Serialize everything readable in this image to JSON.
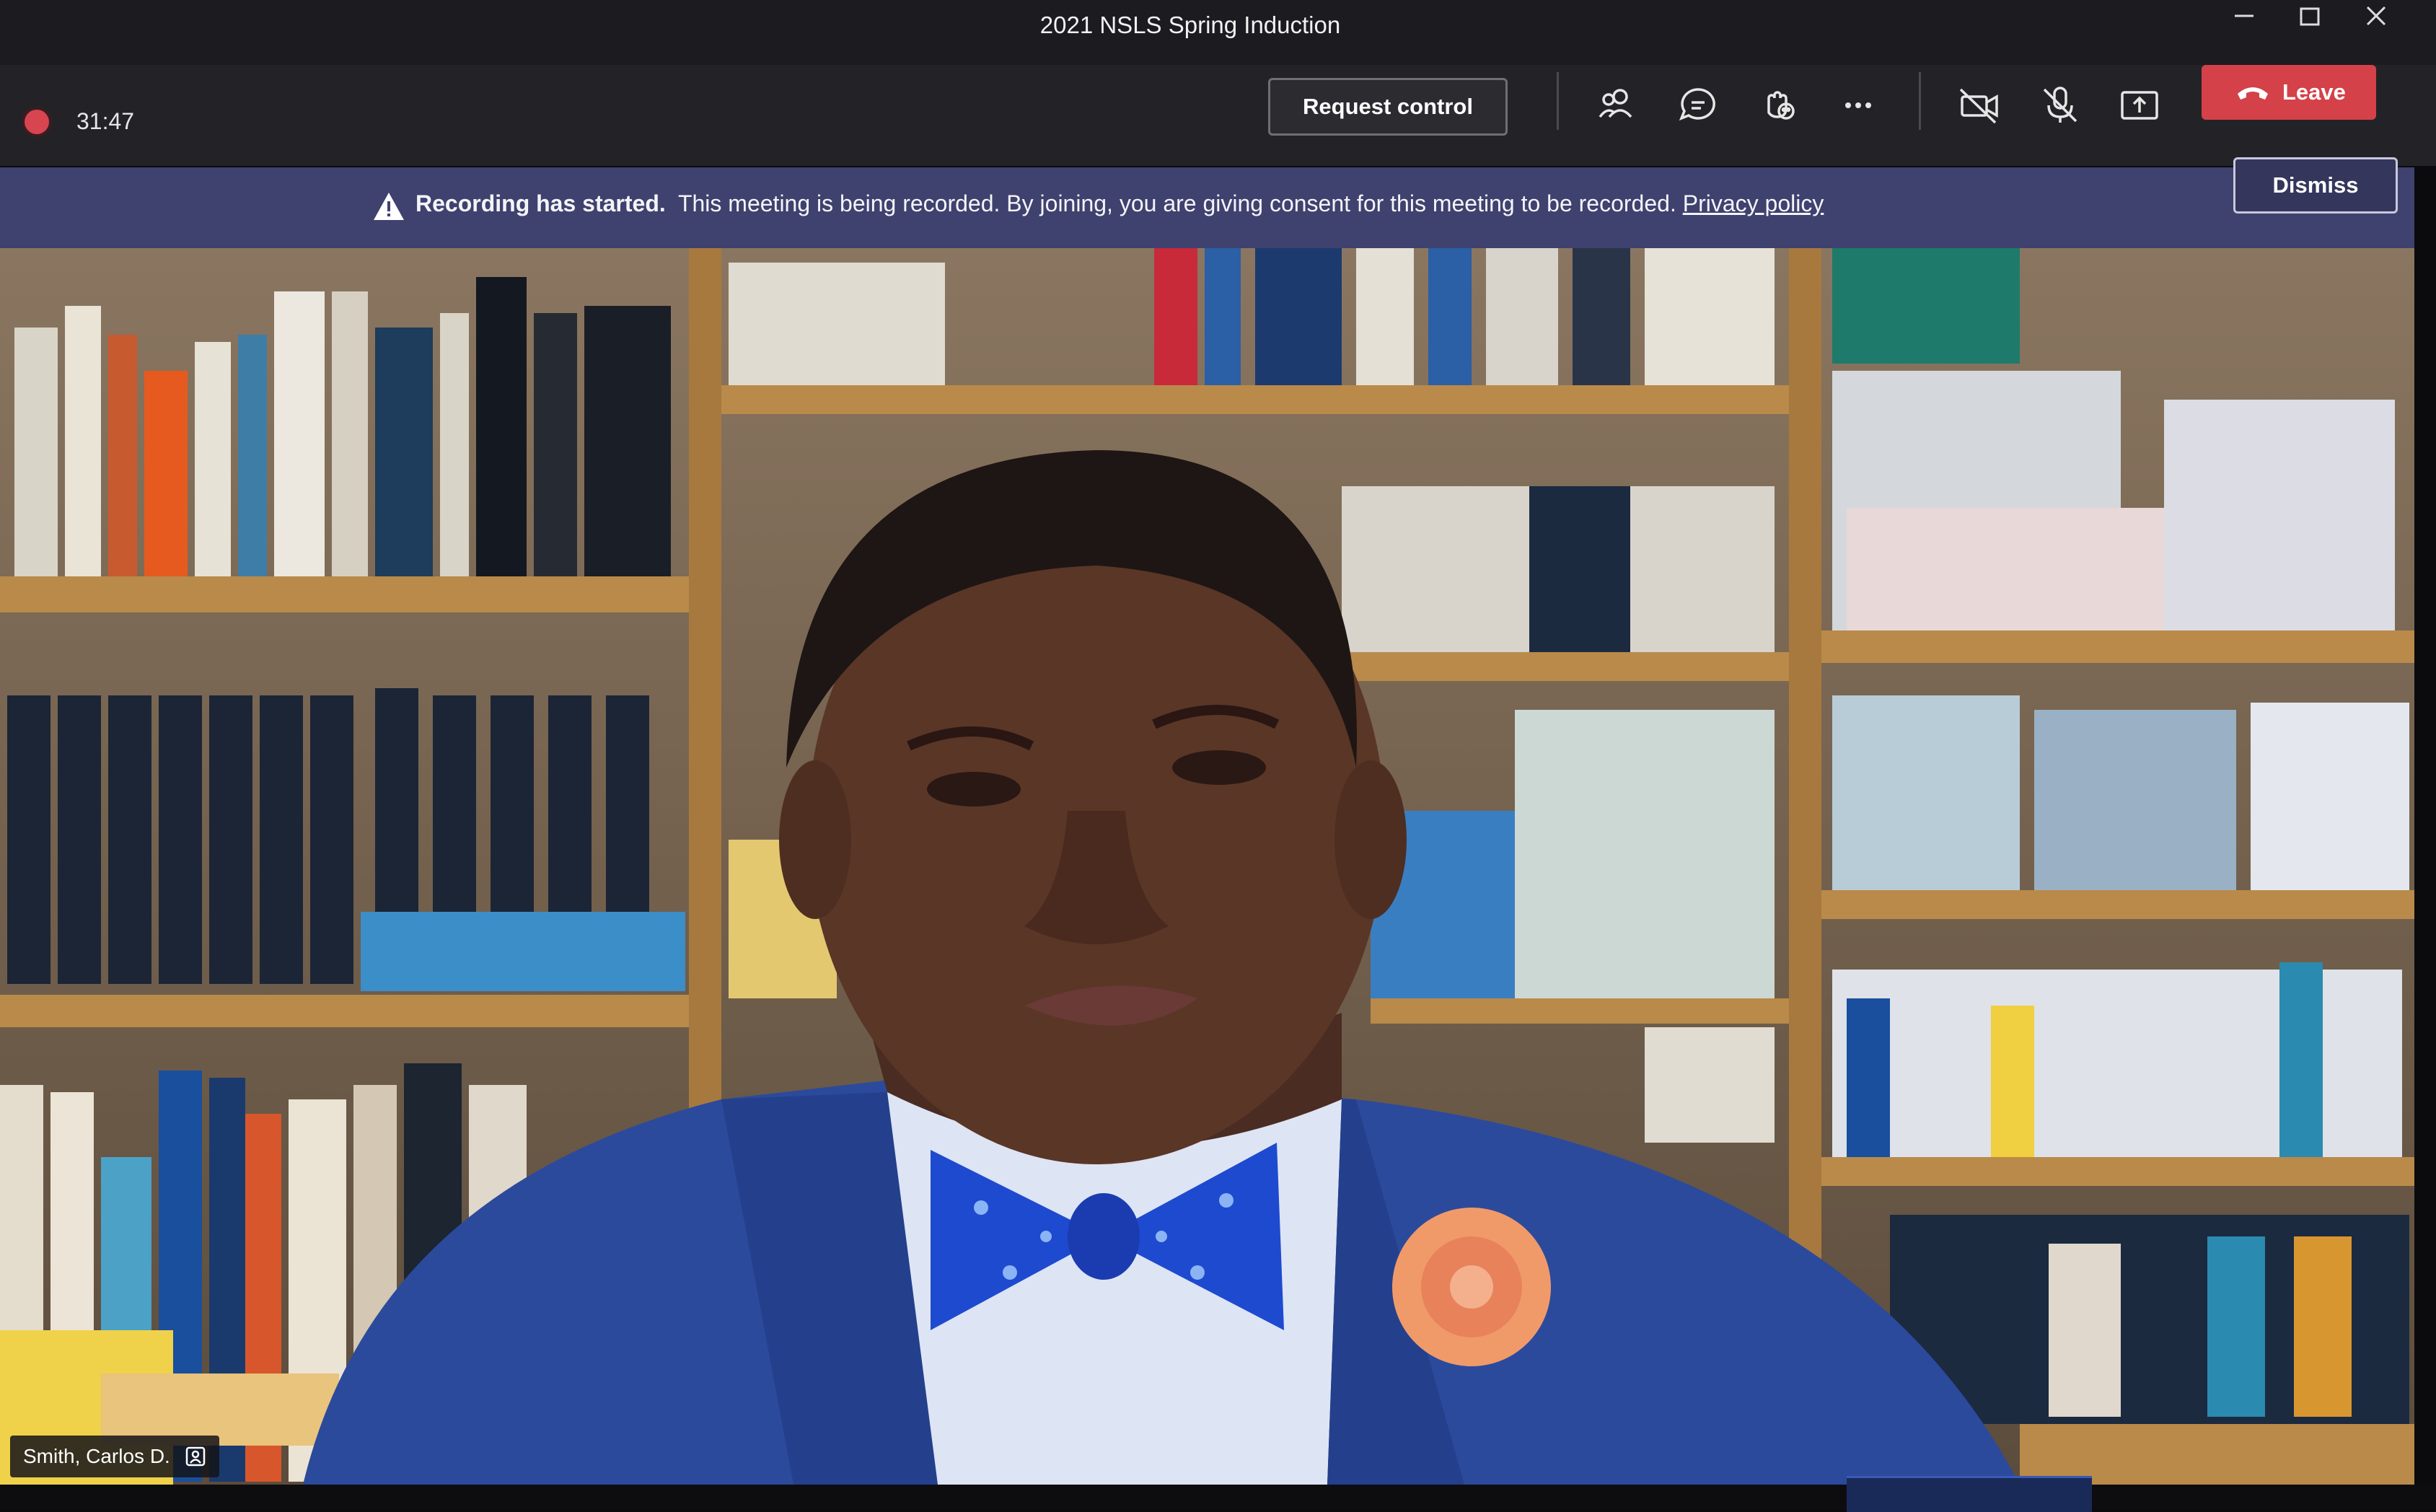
{
  "window": {
    "title": "2021 NSLS Spring Induction",
    "controls": [
      "minimize-icon",
      "maximize-icon",
      "close-icon"
    ]
  },
  "toolbar": {
    "recording_timer": "31:47",
    "request_control_label": "Request control",
    "icons": [
      "participants-icon",
      "chat-icon",
      "reactions-icon",
      "more-options-icon",
      "camera-off-icon",
      "mic-off-icon",
      "share-screen-icon"
    ],
    "leave_label": "Leave",
    "leave_color": "#d44148"
  },
  "notification": {
    "bold_text": "Recording has started.",
    "text": "This meeting is being recorded. By joining, you are giving consent for this meeting to be recorded.",
    "link_text": "Privacy policy",
    "dismiss_label": "Dismiss",
    "background_color": "#3f416e"
  },
  "participant": {
    "name": "Smith, Carlos D."
  }
}
